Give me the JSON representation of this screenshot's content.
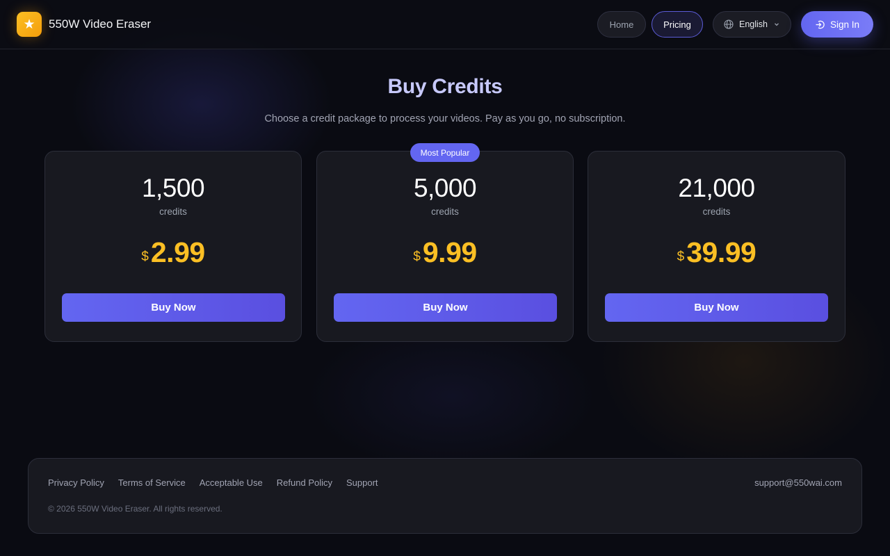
{
  "brand": {
    "logo_glyph": "★",
    "name": "550W Video Eraser",
    "logo_color": "#f59e0b"
  },
  "nav": {
    "home": "Home",
    "pricing": "Pricing",
    "language": "English",
    "sign_in": "Sign In"
  },
  "hero": {
    "title": "Buy Credits",
    "subtitle": "Choose a credit package to process your videos. Pay as you go, no subscription."
  },
  "packages": [
    {
      "credits": "1,500",
      "credits_label": "credits",
      "currency": "$",
      "price": "2.99",
      "button": "Buy Now"
    },
    {
      "credits": "5,000",
      "credits_label": "credits",
      "currency": "$",
      "price": "9.99",
      "button": "Buy Now",
      "badge": "Most Popular"
    },
    {
      "credits": "21,000",
      "credits_label": "credits",
      "currency": "$",
      "price": "39.99",
      "button": "Buy Now"
    }
  ],
  "footer": {
    "links": [
      "Privacy Policy",
      "Terms of Service",
      "Acceptable Use",
      "Refund Policy",
      "Support"
    ],
    "email": "support@550wai.com",
    "copyright": "© 2026 550W Video Eraser. All rights reserved."
  },
  "colors": {
    "accent": "#6366f1",
    "price": "#fbbf24",
    "background": "#0a0b12"
  },
  "icons": [
    "star-icon",
    "globe-icon",
    "chevron-down-icon",
    "sign-in-icon"
  ]
}
